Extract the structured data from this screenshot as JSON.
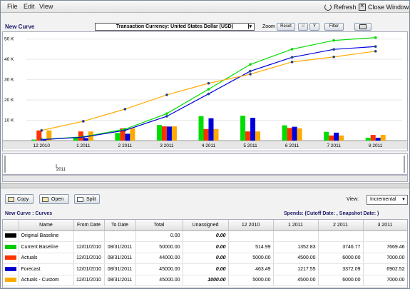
{
  "menu": {
    "file": "File",
    "edit": "Edit",
    "view": "View"
  },
  "window_actions": {
    "refresh": "Refresh",
    "close": "Close Window"
  },
  "panel_title": "New Curve",
  "currency_select": "Transaction Currency: United States Dollar (USD)",
  "zoom": {
    "label": "Zoom",
    "reset": "Reset",
    "prev": "M",
    "next": "Y",
    "filter": "Filter"
  },
  "timeline_label": "2011",
  "toolbar": {
    "copy": "Copy",
    "open": "Open",
    "split": "Split",
    "view_label": "View:",
    "view_value": "Incremental"
  },
  "curves_title": "New Curve : Curves",
  "spends_label": "Spends: (Cutoff Date: , Snapshot Date: )",
  "table": {
    "headers": [
      "",
      "Name",
      "From Date",
      "To Date",
      "Total",
      "Unassigned",
      "12 2010",
      "1 2011",
      "2 2011",
      "3 2011"
    ],
    "rows": [
      {
        "color": "#000000",
        "name": "Original Baseline",
        "from": "",
        "to": "",
        "total": "0.00",
        "unassigned": "0.00",
        "c1": "",
        "c2": "",
        "c3": "",
        "c4": ""
      },
      {
        "color": "#00cc00",
        "name": "Current Baseline",
        "from": "12/01/2010",
        "to": "08/31/2011",
        "total": "50000.00",
        "unassigned": "0.00",
        "c1": "514.99",
        "c2": "1352.83",
        "c3": "3746.77",
        "c4": "7669.46"
      },
      {
        "color": "#ff3300",
        "name": "Actuals",
        "from": "12/01/2010",
        "to": "08/31/2011",
        "total": "44000.00",
        "unassigned": "0.00",
        "c1": "5000.00",
        "c2": "4500.00",
        "c3": "6000.00",
        "c4": "7000.00"
      },
      {
        "color": "#0000cc",
        "name": "Forecast",
        "from": "12/01/2010",
        "to": "08/31/2011",
        "total": "45000.00",
        "unassigned": "0.00",
        "c1": "463.49",
        "c2": "1217.55",
        "c3": "3372.09",
        "c4": "6902.52"
      },
      {
        "color": "#ffaa00",
        "name": "Actuals - Custom",
        "from": "12/01/2010",
        "to": "08/31/2011",
        "total": "45000.00",
        "unassigned": "1000.00",
        "c1": "5000.00",
        "c2": "4500.00",
        "c3": "6000.00",
        "c4": "7000.00"
      }
    ]
  },
  "colors": {
    "green": "#00dd00",
    "red": "#ff3300",
    "blue": "#0000dd",
    "orange": "#ffaa00"
  },
  "chart_data": {
    "type": "bar",
    "categories": [
      "12 2010",
      "1 2011",
      "2 2011",
      "3 2011",
      "4 2011",
      "5 2011",
      "6 2011",
      "7 2011",
      "8 2011"
    ],
    "ytick_labels": [
      "10 K",
      "20 K",
      "30 K",
      "40 K",
      "50 K"
    ],
    "ylim": [
      0,
      52000
    ],
    "bar_series": [
      {
        "name": "Current Baseline",
        "color": "#00dd00",
        "values": [
          515,
          1353,
          3747,
          7669,
          12000,
          12200,
          7500,
          4300,
          1400
        ]
      },
      {
        "name": "Actuals",
        "color": "#ff3300",
        "values": [
          5000,
          4500,
          6000,
          7000,
          5700,
          4500,
          6200,
          2500,
          2800
        ]
      },
      {
        "name": "Forecast",
        "color": "#0000dd",
        "values": [
          463,
          1218,
          3372,
          6903,
          11000,
          11200,
          6800,
          3900,
          1400
        ]
      },
      {
        "name": "Actuals - Custom",
        "color": "#ffaa00",
        "values": [
          5000,
          4500,
          6000,
          7000,
          5700,
          4500,
          6000,
          2500,
          2800
        ]
      }
    ],
    "line_series": [
      {
        "name": "Current Baseline",
        "color": "#00dd00",
        "values": [
          515,
          1868,
          5615,
          13284,
          25300,
          37500,
          45000,
          49300,
          50700
        ]
      },
      {
        "name": "Forecast",
        "color": "#0000dd",
        "values": [
          463,
          1681,
          5053,
          11956,
          23000,
          34200,
          41000,
          44900,
          46300
        ]
      },
      {
        "name": "Actuals - Custom",
        "color": "#ffaa00",
        "values": [
          5000,
          9500,
          15500,
          22500,
          28200,
          32700,
          38700,
          41200,
          44000
        ]
      }
    ]
  }
}
